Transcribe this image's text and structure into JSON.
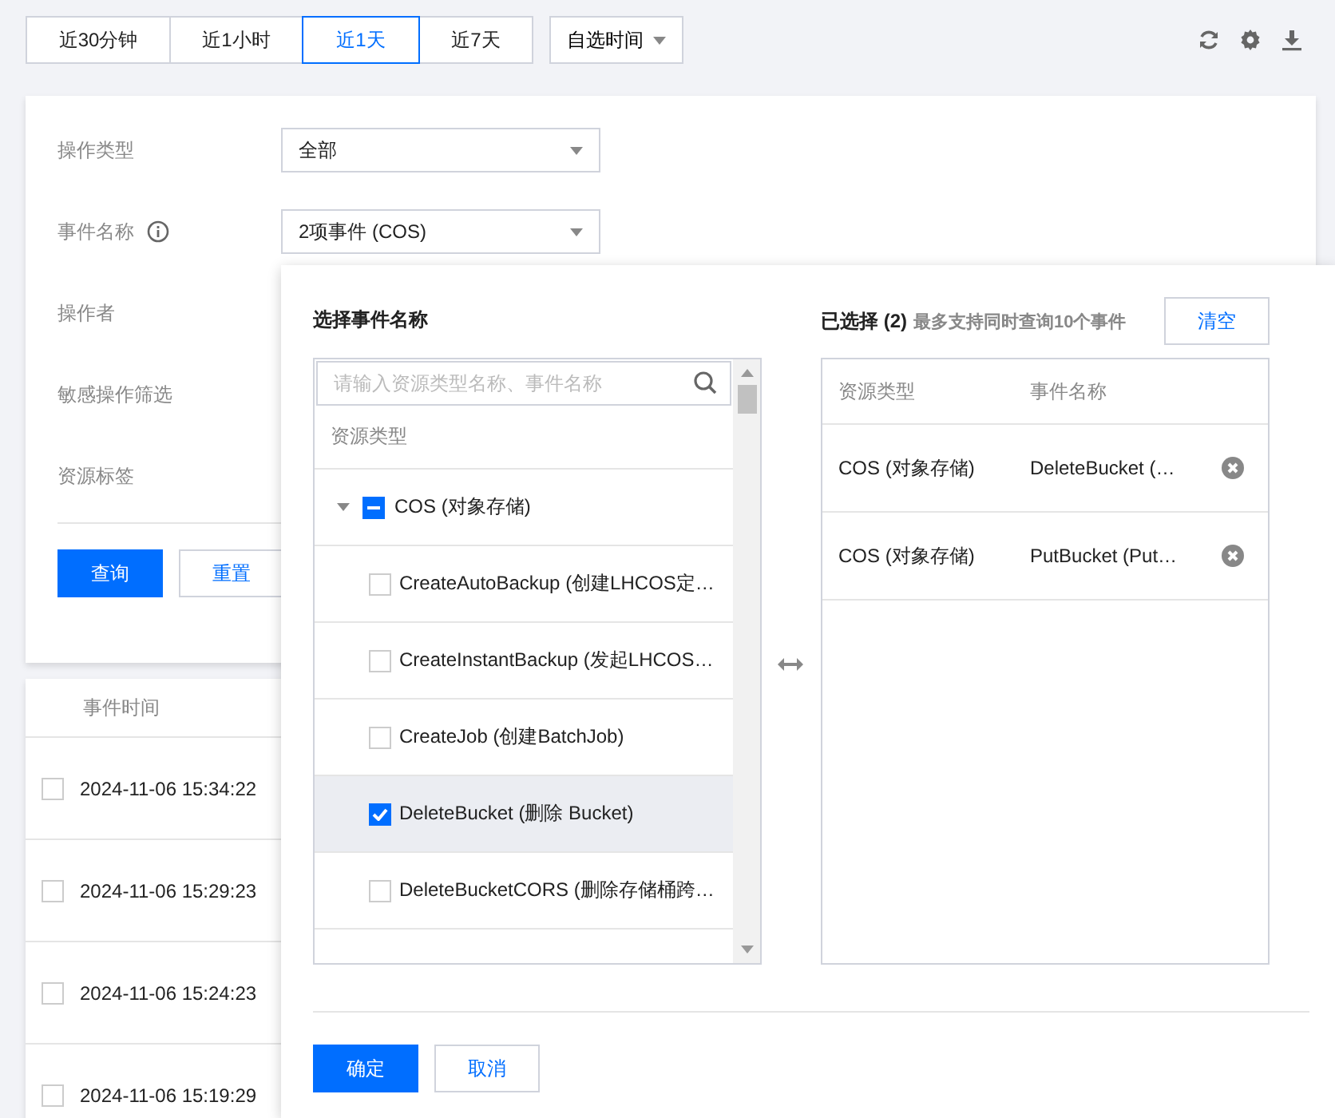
{
  "time_ranges": [
    {
      "label": "近30分钟",
      "selected": false
    },
    {
      "label": "近1小时",
      "selected": false
    },
    {
      "label": "近1天",
      "selected": true
    },
    {
      "label": "近7天",
      "selected": false
    }
  ],
  "custom_time": {
    "label": "自选时间"
  },
  "filters": [
    {
      "label": "操作类型",
      "kind": "select",
      "value": "全部"
    },
    {
      "label": "事件名称",
      "kind": "select",
      "value": "2项事件 (COS)",
      "info": true
    },
    {
      "label": "操作者",
      "kind": "hidden"
    },
    {
      "label": "敏感操作筛选",
      "kind": "hidden"
    },
    {
      "label": "资源标签",
      "kind": "hidden"
    }
  ],
  "actions": {
    "query": "查询",
    "reset": "重置"
  },
  "table": {
    "columns": [
      "事件时间"
    ],
    "rows": [
      {
        "time": "2024-11-06 15:34:22",
        "checked": false
      },
      {
        "time": "2024-11-06 15:29:23",
        "checked": false
      },
      {
        "time": "2024-11-06 15:24:23",
        "checked": false
      },
      {
        "time": "2024-11-06 15:19:29",
        "checked": false
      }
    ]
  },
  "picker": {
    "title": "选择事件名称",
    "search_placeholder": "请输入资源类型名称、事件名称",
    "column": "资源类型",
    "group": {
      "label": "COS (对象存储)",
      "expanded": true,
      "indeterminate": true
    },
    "items": [
      {
        "label": "CreateAutoBackup (创建LHCOS定…",
        "checked": false
      },
      {
        "label": "CreateInstantBackup (发起LHCOS…",
        "checked": false
      },
      {
        "label": "CreateJob (创建BatchJob)",
        "checked": false
      },
      {
        "label": "DeleteBucket (删除 Bucket)",
        "checked": true
      },
      {
        "label": "DeleteBucketCORS (删除存储桶跨…",
        "checked": false
      }
    ],
    "selected_title": "已选择 (2)",
    "selected_hint": "最多支持同时查询10个事件",
    "clear": "清空",
    "selected_columns": [
      "资源类型",
      "事件名称"
    ],
    "selected_rows": [
      {
        "type": "COS (对象存储)",
        "event": "DeleteBucket (…"
      },
      {
        "type": "COS (对象存储)",
        "event": "PutBucket (Put…"
      }
    ],
    "confirm": "确定",
    "cancel": "取消"
  }
}
